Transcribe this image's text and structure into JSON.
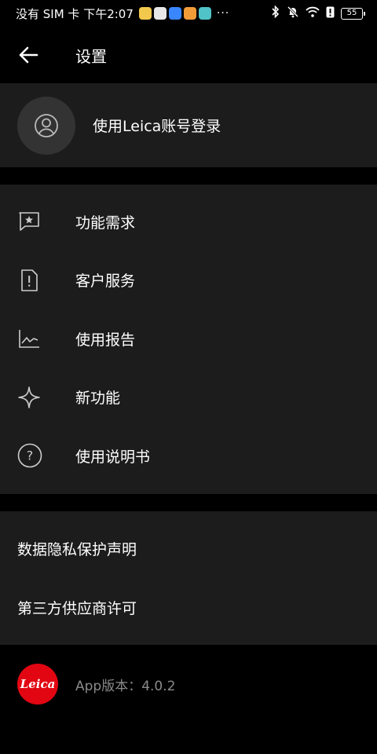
{
  "status_bar": {
    "carrier_text": "没有 SIM 卡 下午2:07",
    "more": "···",
    "battery": "55",
    "app_icons": [
      {
        "name": "app-icon-yellow",
        "color": "#f2c94c"
      },
      {
        "name": "app-icon-mail",
        "color": "#e8e8e8"
      },
      {
        "name": "app-icon-cloud",
        "color": "#3a86ff"
      },
      {
        "name": "app-icon-video",
        "color": "#f29c38"
      },
      {
        "name": "app-icon-teal",
        "color": "#4fc3c7"
      }
    ]
  },
  "header": {
    "title": "设置",
    "back_icon": "arrow-left-icon"
  },
  "account": {
    "label": "使用Leica账号登录",
    "icon": "user-icon"
  },
  "menu": {
    "items": [
      {
        "label": "功能需求",
        "icon": "star-chat-icon"
      },
      {
        "label": "客户服务",
        "icon": "alert-document-icon"
      },
      {
        "label": "使用报告",
        "icon": "chart-line-icon"
      },
      {
        "label": "新功能",
        "icon": "sparkle-icon"
      },
      {
        "label": "使用说明书",
        "icon": "help-circle-icon"
      }
    ]
  },
  "links": {
    "items": [
      {
        "label": "数据隐私保护声明"
      },
      {
        "label": "第三方供应商许可"
      }
    ]
  },
  "footer": {
    "logo_text": "Leica",
    "version": "App版本：4.0.2"
  },
  "colors": {
    "background": "#000000",
    "card": "#1c1c1c",
    "brand_red": "#e20612",
    "muted_text": "#8a8a8a"
  }
}
